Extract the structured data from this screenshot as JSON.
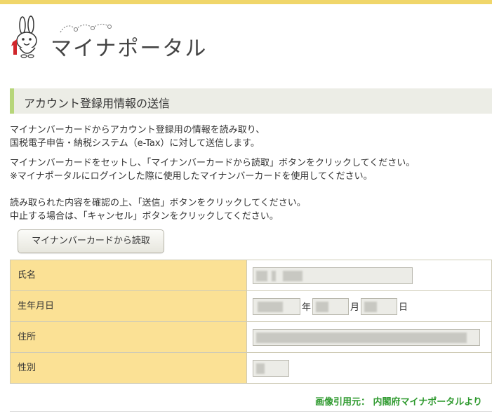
{
  "logo": {
    "title": "マイナポータル"
  },
  "section": {
    "title": "アカウント登録用情報の送信"
  },
  "intro": {
    "line1": "マイナンバーカードからアカウント登録用の情報を読み取り、",
    "line2": "国税電子申告・納税システム（e-Tax）に対して送信します。",
    "line3": "マイナンバーカードをセットし、「マイナンバーカードから読取」ボタンをクリックしてください。",
    "line4": "※マイナポータルにログインした際に使用したマイナンバーカードを使用してください。",
    "line5": "読み取られた内容を確認の上、「送信」ボタンをクリックしてください。",
    "line6": "中止する場合は、「キャンセル」ボタンをクリックしてください。"
  },
  "read_button": {
    "label": "マイナンバーカードから読取"
  },
  "form": {
    "name_label": "氏名",
    "birth_label": "生年月日",
    "birth_year_unit": "年",
    "birth_month_unit": "月",
    "birth_day_unit": "日",
    "address_label": "住所",
    "gender_label": "性別"
  },
  "credit": {
    "text": "画像引用元： 内閣府マイナポータルより"
  },
  "colors": {
    "top_bar": "#f0d66a",
    "section_accent": "#b7d67a",
    "section_bg": "#ecede6",
    "label_bg": "#fbe195",
    "credit_text": "#2f9a2f"
  }
}
